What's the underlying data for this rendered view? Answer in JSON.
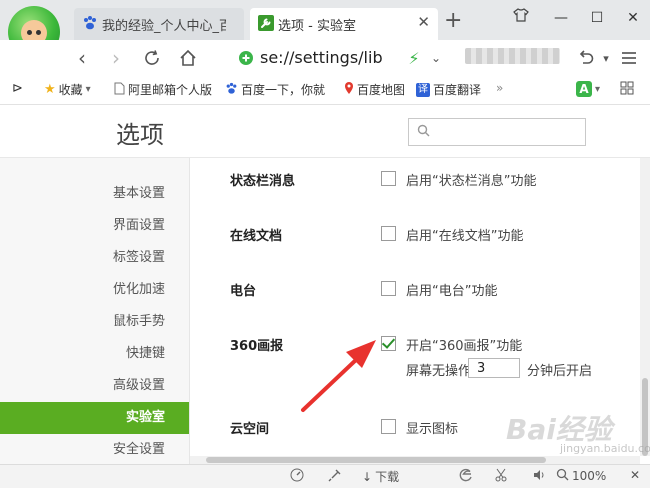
{
  "browser": {
    "tabs": [
      {
        "title": "我的经验_个人中心_百度",
        "active": false
      },
      {
        "title": "选项 - 实验室",
        "active": true
      }
    ],
    "address": "se://settings/lib"
  },
  "bookmarks": [
    {
      "label": "收藏",
      "icon": "star-icon"
    },
    {
      "label": "阿里邮箱个人版",
      "icon": "page-icon"
    },
    {
      "label": "百度一下，你就",
      "icon": "paw-icon"
    },
    {
      "label": "百度地图",
      "icon": "map-pin-icon"
    },
    {
      "label": "百度翻译",
      "icon": "translate-icon"
    }
  ],
  "options": {
    "title": "选项",
    "search_placeholder": ""
  },
  "sidebar": {
    "items": [
      {
        "label": "基本设置",
        "active": false
      },
      {
        "label": "界面设置",
        "active": false
      },
      {
        "label": "标签设置",
        "active": false
      },
      {
        "label": "优化加速",
        "active": false
      },
      {
        "label": "鼠标手势",
        "active": false
      },
      {
        "label": "快捷键",
        "active": false
      },
      {
        "label": "高级设置",
        "active": false
      },
      {
        "label": "实验室",
        "active": true
      },
      {
        "label": "安全设置",
        "active": false
      }
    ]
  },
  "settings": [
    {
      "label": "状态栏消息",
      "option": "启用“状态栏消息”功能",
      "checked": false
    },
    {
      "label": "在线文档",
      "option": "启用“在线文档”功能",
      "checked": false
    },
    {
      "label": "电台",
      "option": "启用“电台”功能",
      "checked": false
    },
    {
      "label": "360画报",
      "option": "开启“360画报”功能",
      "checked": true,
      "sub_prefix": "屏幕无操作",
      "sub_value": "3",
      "sub_suffix": "分钟后开启"
    },
    {
      "label": "云空间",
      "option": "显示图标",
      "checked": false
    }
  ],
  "statusbar": {
    "download": "下载",
    "zoom": "100%"
  },
  "watermark": {
    "text": "Bai经验",
    "sub": "jingyan.baidu.com"
  },
  "colors": {
    "active_green": "#5aad22",
    "arrow_red": "#e8322e",
    "check_green": "#2a8f2a"
  }
}
